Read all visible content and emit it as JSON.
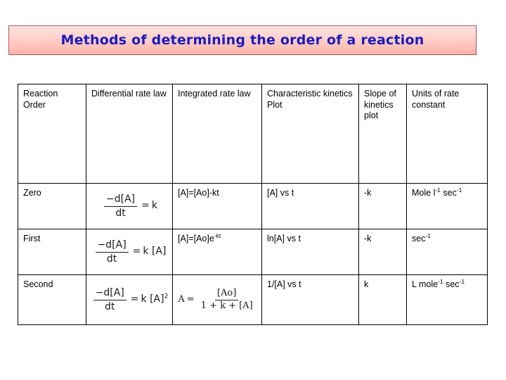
{
  "slide": {
    "title": "Methods of determining the order of a reaction",
    "title_text_color": "#1b1bbd",
    "title_bg_top": "#ffe3e0",
    "title_bg_bottom": "#ffb3a8",
    "title_border_color": "#b05b6b"
  },
  "table": {
    "headers": [
      "Reaction Order",
      "Differential rate law",
      "Integrated rate law",
      "Characteristic kinetics Plot",
      "Slope of kinetics plot",
      "Units of rate constant"
    ],
    "rows": [
      {
        "order": "Zero",
        "differential": {
          "numerator": "−d[A]",
          "denominator": "dt",
          "operator": "=",
          "rhs": "k",
          "exponent": ""
        },
        "integrated": {
          "text": "[A]=[Ao]-kt",
          "superscript": ""
        },
        "plot": "[A] vs t",
        "slope": "-k",
        "units_main": "Mole l",
        "units_sup1": "-1",
        "units_mid": " sec",
        "units_sup2": "-1"
      },
      {
        "order": "First",
        "differential": {
          "numerator": "−d[A]",
          "denominator": "dt",
          "operator": "=",
          "rhs": "k [A]",
          "exponent": ""
        },
        "integrated": {
          "text": "[A]=[Ao]e",
          "superscript": "-kt"
        },
        "plot": "ln[A] vs t",
        "slope": "-k",
        "units_main": "sec",
        "units_sup1": "-1",
        "units_mid": "",
        "units_sup2": ""
      },
      {
        "order": "Second",
        "differential": {
          "numerator": "−d[A]",
          "denominator": "dt",
          "operator": "=",
          "rhs": "k [A]",
          "exponent": "2"
        },
        "integrated_equation": {
          "lhs": "A",
          "operator": "=",
          "numerator": "[Ao]",
          "denominator": "1 + k + [A]"
        },
        "plot": "1/[A] vs t",
        "slope": "k",
        "units_main": "L mole",
        "units_sup1": "-1",
        "units_mid": " sec",
        "units_sup2": "-1"
      }
    ]
  }
}
